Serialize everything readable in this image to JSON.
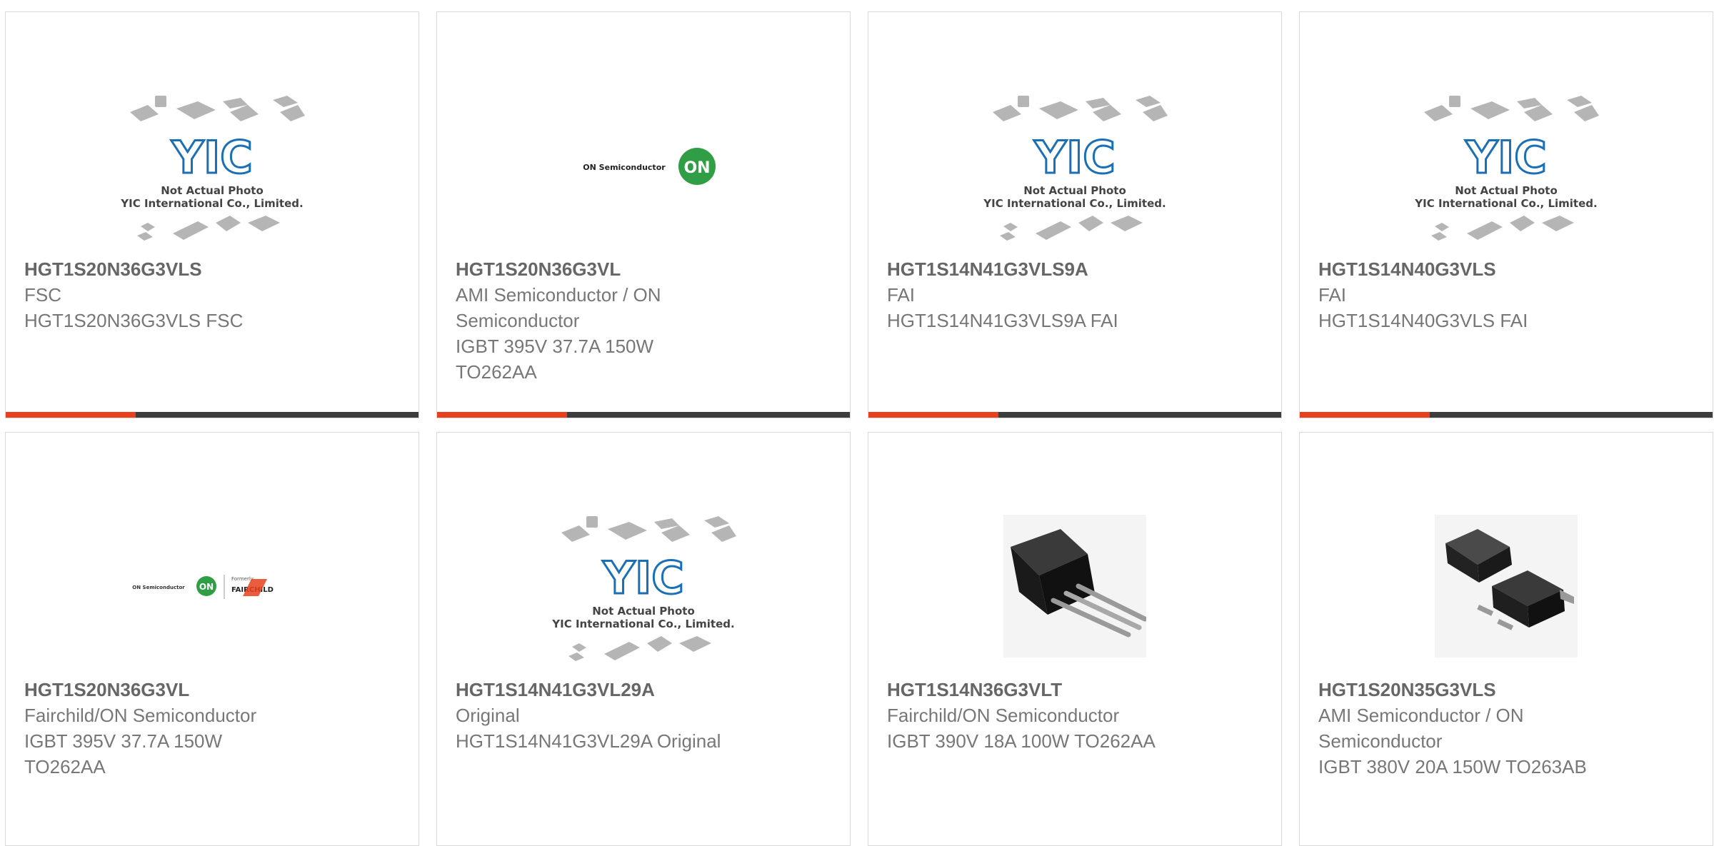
{
  "colors": {
    "accent": "#e8401c",
    "bar": "#3d3d3d",
    "part_text": "#666666",
    "desc_text": "#777777",
    "yic_blue": "#1a6fb5",
    "on_green": "#2f9e44"
  },
  "placeholder": {
    "line1": "Not Actual Photo",
    "line2": "YIC International Co., Limited.",
    "logo": "YIC"
  },
  "brand_logos": {
    "on_text": "ON Semiconductor",
    "on_badge": "ON",
    "fairchild_small": "Formerly",
    "fairchild_name": "FAIRCHILD"
  },
  "products": [
    {
      "part": "HGT1S20N36G3VLS",
      "lines": [
        "FSC",
        "HGT1S20N36G3VLS FSC"
      ],
      "image": "yic-placeholder"
    },
    {
      "part": "HGT1S20N36G3VL",
      "lines": [
        "AMI Semiconductor / ON",
        "Semiconductor",
        "IGBT 395V 37.7A 150W",
        "TO262AA"
      ],
      "image": "on-semi-logo"
    },
    {
      "part": "HGT1S14N41G3VLS9A",
      "lines": [
        "FAI",
        "HGT1S14N41G3VLS9A FAI"
      ],
      "image": "yic-placeholder"
    },
    {
      "part": "HGT1S14N40G3VLS",
      "lines": [
        "FAI",
        "HGT1S14N40G3VLS FAI"
      ],
      "image": "yic-placeholder"
    },
    {
      "part": "HGT1S20N36G3VL",
      "lines": [
        "Fairchild/ON Semiconductor",
        "IGBT 395V 37.7A 150W",
        "TO262AA"
      ],
      "image": "on-fairchild-logo"
    },
    {
      "part": "HGT1S14N41G3VL29A",
      "lines": [
        "Original",
        "HGT1S14N41G3VL29A Original"
      ],
      "image": "yic-placeholder"
    },
    {
      "part": "HGT1S14N36G3VLT",
      "lines": [
        "Fairchild/ON Semiconductor",
        "IGBT 390V 18A 100W TO262AA"
      ],
      "image": "to262-photo"
    },
    {
      "part": "HGT1S20N35G3VLS",
      "lines": [
        "AMI Semiconductor / ON",
        "Semiconductor",
        "IGBT 380V 20A 150W TO263AB"
      ],
      "image": "to263-photo"
    }
  ]
}
